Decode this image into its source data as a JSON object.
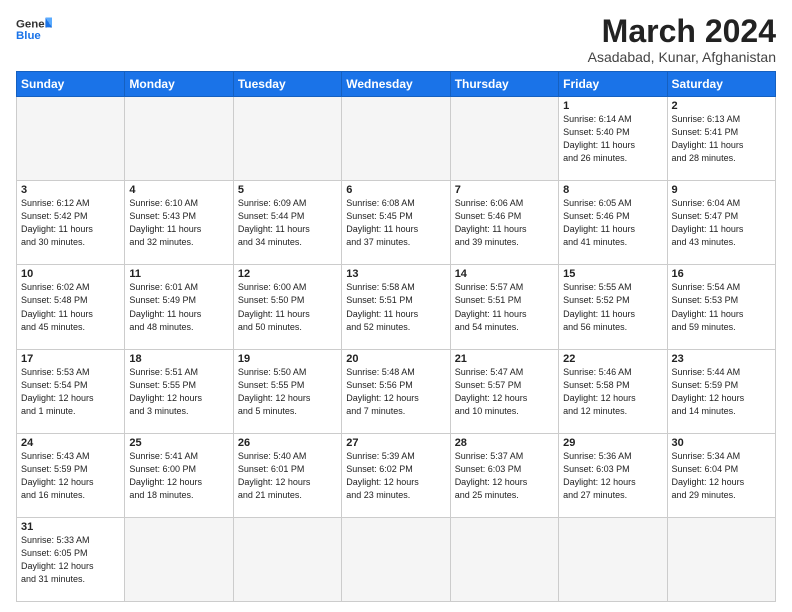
{
  "header": {
    "logo_general": "General",
    "logo_blue": "Blue",
    "month_title": "March 2024",
    "location": "Asadabad, Kunar, Afghanistan"
  },
  "weekdays": [
    "Sunday",
    "Monday",
    "Tuesday",
    "Wednesday",
    "Thursday",
    "Friday",
    "Saturday"
  ],
  "weeks": [
    [
      {
        "day": "",
        "info": "",
        "empty": true
      },
      {
        "day": "",
        "info": "",
        "empty": true
      },
      {
        "day": "",
        "info": "",
        "empty": true
      },
      {
        "day": "",
        "info": "",
        "empty": true
      },
      {
        "day": "",
        "info": "",
        "empty": true
      },
      {
        "day": "1",
        "info": "Sunrise: 6:14 AM\nSunset: 5:40 PM\nDaylight: 11 hours\nand 26 minutes."
      },
      {
        "day": "2",
        "info": "Sunrise: 6:13 AM\nSunset: 5:41 PM\nDaylight: 11 hours\nand 28 minutes."
      }
    ],
    [
      {
        "day": "3",
        "info": "Sunrise: 6:12 AM\nSunset: 5:42 PM\nDaylight: 11 hours\nand 30 minutes."
      },
      {
        "day": "4",
        "info": "Sunrise: 6:10 AM\nSunset: 5:43 PM\nDaylight: 11 hours\nand 32 minutes."
      },
      {
        "day": "5",
        "info": "Sunrise: 6:09 AM\nSunset: 5:44 PM\nDaylight: 11 hours\nand 34 minutes."
      },
      {
        "day": "6",
        "info": "Sunrise: 6:08 AM\nSunset: 5:45 PM\nDaylight: 11 hours\nand 37 minutes."
      },
      {
        "day": "7",
        "info": "Sunrise: 6:06 AM\nSunset: 5:46 PM\nDaylight: 11 hours\nand 39 minutes."
      },
      {
        "day": "8",
        "info": "Sunrise: 6:05 AM\nSunset: 5:46 PM\nDaylight: 11 hours\nand 41 minutes."
      },
      {
        "day": "9",
        "info": "Sunrise: 6:04 AM\nSunset: 5:47 PM\nDaylight: 11 hours\nand 43 minutes."
      }
    ],
    [
      {
        "day": "10",
        "info": "Sunrise: 6:02 AM\nSunset: 5:48 PM\nDaylight: 11 hours\nand 45 minutes."
      },
      {
        "day": "11",
        "info": "Sunrise: 6:01 AM\nSunset: 5:49 PM\nDaylight: 11 hours\nand 48 minutes."
      },
      {
        "day": "12",
        "info": "Sunrise: 6:00 AM\nSunset: 5:50 PM\nDaylight: 11 hours\nand 50 minutes."
      },
      {
        "day": "13",
        "info": "Sunrise: 5:58 AM\nSunset: 5:51 PM\nDaylight: 11 hours\nand 52 minutes."
      },
      {
        "day": "14",
        "info": "Sunrise: 5:57 AM\nSunset: 5:51 PM\nDaylight: 11 hours\nand 54 minutes."
      },
      {
        "day": "15",
        "info": "Sunrise: 5:55 AM\nSunset: 5:52 PM\nDaylight: 11 hours\nand 56 minutes."
      },
      {
        "day": "16",
        "info": "Sunrise: 5:54 AM\nSunset: 5:53 PM\nDaylight: 11 hours\nand 59 minutes."
      }
    ],
    [
      {
        "day": "17",
        "info": "Sunrise: 5:53 AM\nSunset: 5:54 PM\nDaylight: 12 hours\nand 1 minute."
      },
      {
        "day": "18",
        "info": "Sunrise: 5:51 AM\nSunset: 5:55 PM\nDaylight: 12 hours\nand 3 minutes."
      },
      {
        "day": "19",
        "info": "Sunrise: 5:50 AM\nSunset: 5:55 PM\nDaylight: 12 hours\nand 5 minutes."
      },
      {
        "day": "20",
        "info": "Sunrise: 5:48 AM\nSunset: 5:56 PM\nDaylight: 12 hours\nand 7 minutes."
      },
      {
        "day": "21",
        "info": "Sunrise: 5:47 AM\nSunset: 5:57 PM\nDaylight: 12 hours\nand 10 minutes."
      },
      {
        "day": "22",
        "info": "Sunrise: 5:46 AM\nSunset: 5:58 PM\nDaylight: 12 hours\nand 12 minutes."
      },
      {
        "day": "23",
        "info": "Sunrise: 5:44 AM\nSunset: 5:59 PM\nDaylight: 12 hours\nand 14 minutes."
      }
    ],
    [
      {
        "day": "24",
        "info": "Sunrise: 5:43 AM\nSunset: 5:59 PM\nDaylight: 12 hours\nand 16 minutes."
      },
      {
        "day": "25",
        "info": "Sunrise: 5:41 AM\nSunset: 6:00 PM\nDaylight: 12 hours\nand 18 minutes."
      },
      {
        "day": "26",
        "info": "Sunrise: 5:40 AM\nSunset: 6:01 PM\nDaylight: 12 hours\nand 21 minutes."
      },
      {
        "day": "27",
        "info": "Sunrise: 5:39 AM\nSunset: 6:02 PM\nDaylight: 12 hours\nand 23 minutes."
      },
      {
        "day": "28",
        "info": "Sunrise: 5:37 AM\nSunset: 6:03 PM\nDaylight: 12 hours\nand 25 minutes."
      },
      {
        "day": "29",
        "info": "Sunrise: 5:36 AM\nSunset: 6:03 PM\nDaylight: 12 hours\nand 27 minutes."
      },
      {
        "day": "30",
        "info": "Sunrise: 5:34 AM\nSunset: 6:04 PM\nDaylight: 12 hours\nand 29 minutes."
      }
    ],
    [
      {
        "day": "31",
        "info": "Sunrise: 5:33 AM\nSunset: 6:05 PM\nDaylight: 12 hours\nand 31 minutes."
      },
      {
        "day": "",
        "info": "",
        "empty": true
      },
      {
        "day": "",
        "info": "",
        "empty": true
      },
      {
        "day": "",
        "info": "",
        "empty": true
      },
      {
        "day": "",
        "info": "",
        "empty": true
      },
      {
        "day": "",
        "info": "",
        "empty": true
      },
      {
        "day": "",
        "info": "",
        "empty": true
      }
    ]
  ]
}
